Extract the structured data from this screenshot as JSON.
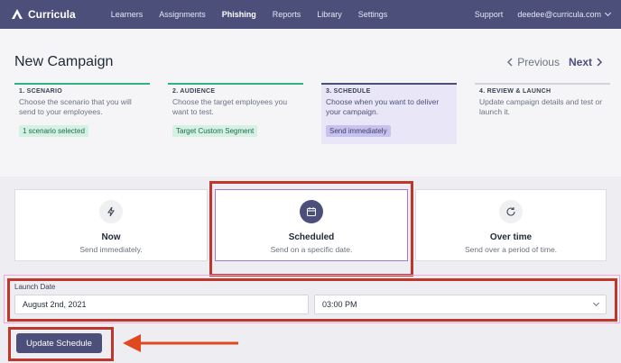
{
  "nav": {
    "brand": "Curricula",
    "items": [
      "Learners",
      "Assignments",
      "Phishing",
      "Reports",
      "Library",
      "Settings"
    ],
    "active_index": 2,
    "support": "Support",
    "user_email": "deedee@curricula.com"
  },
  "header": {
    "title": "New Campaign",
    "previous_label": "Previous",
    "next_label": "Next"
  },
  "steps": [
    {
      "label": "1. SCENARIO",
      "desc": "Choose the scenario that you will send to your employees.",
      "badge": "1 scenario selected"
    },
    {
      "label": "2. AUDIENCE",
      "desc": "Choose the target employees you want to test.",
      "badge": "Target Custom Segment"
    },
    {
      "label": "3. SCHEDULE",
      "desc": "Choose when you want to deliver your campaign.",
      "badge": "Send immediately"
    },
    {
      "label": "4. REVIEW & LAUNCH",
      "desc": "Update campaign details and test or launch it.",
      "badge": ""
    }
  ],
  "schedule_options": [
    {
      "title": "Now",
      "subtitle": "Send immediately.",
      "icon": "lightning-icon"
    },
    {
      "title": "Scheduled",
      "subtitle": "Send on a specific date.",
      "icon": "calendar-icon"
    },
    {
      "title": "Over time",
      "subtitle": "Send over a period of time.",
      "icon": "refresh-icon"
    }
  ],
  "launch": {
    "label": "Launch Date",
    "date_value": "August 2nd, 2021",
    "time_value": "03:00 PM"
  },
  "update_button": "Update Schedule",
  "colors": {
    "nav_bg": "#4b4f7a",
    "complete_step": "#2fb380",
    "annotation": "#c0362b",
    "selected_border": "#9a7ad6"
  }
}
